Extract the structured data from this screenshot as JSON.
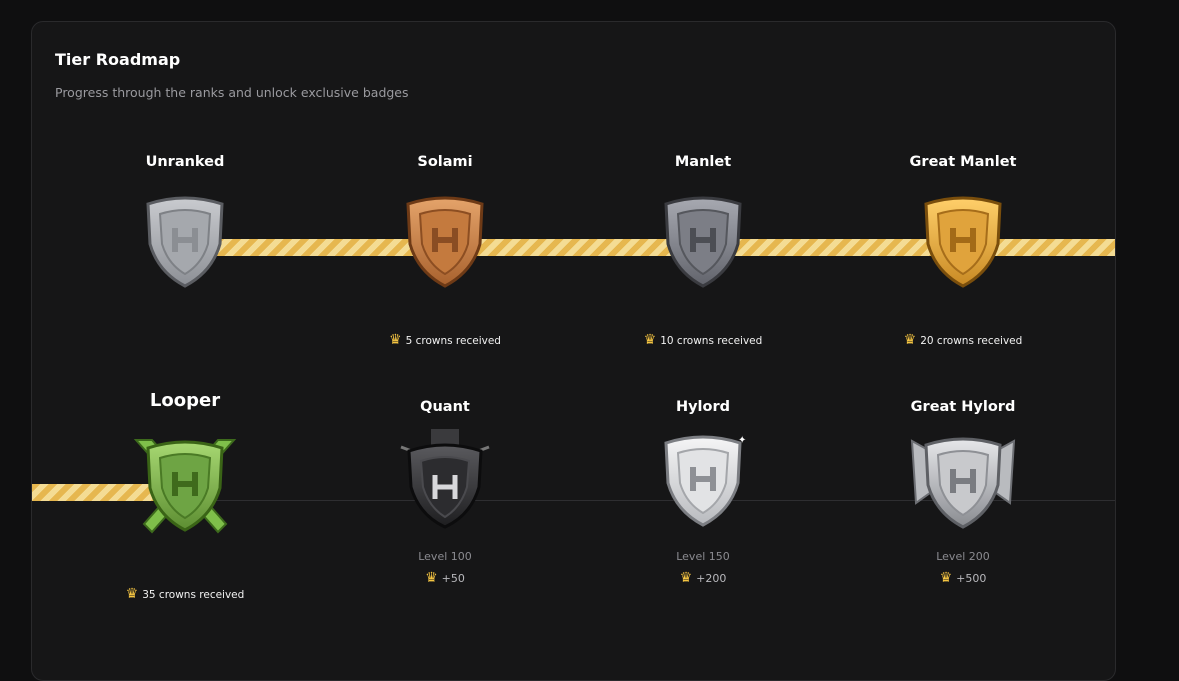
{
  "header": {
    "title": "Tier Roadmap",
    "subtitle": "Progress through the ranks and unlock exclusive badges"
  },
  "colors": {
    "track_gold": "#e6b74f",
    "track_light": "#f4dc94",
    "crown": "#f5c542"
  },
  "row1": [
    {
      "name": "Unranked",
      "badge": "silver-gray-shield-icon",
      "req": ""
    },
    {
      "name": "Solami",
      "badge": "bronze-shield-icon",
      "req": "5 crowns received"
    },
    {
      "name": "Manlet",
      "badge": "steel-shield-icon",
      "req": "10 crowns received"
    },
    {
      "name": "Great Manlet",
      "badge": "gold-shield-icon",
      "req": "20 crowns received"
    }
  ],
  "row2": [
    {
      "name": "Looper",
      "badge": "green-crossed-swords-shield-icon",
      "req": "35 crowns received",
      "current": true
    },
    {
      "name": "Quant",
      "badge": "dark-banner-shield-icon",
      "level": "Level 100",
      "reward": "+50"
    },
    {
      "name": "Hylord",
      "badge": "platinum-shield-icon",
      "level": "Level 150",
      "reward": "+200"
    },
    {
      "name": "Great Hylord",
      "badge": "winged-silver-shield-icon",
      "level": "Level 200",
      "reward": "+500"
    }
  ]
}
